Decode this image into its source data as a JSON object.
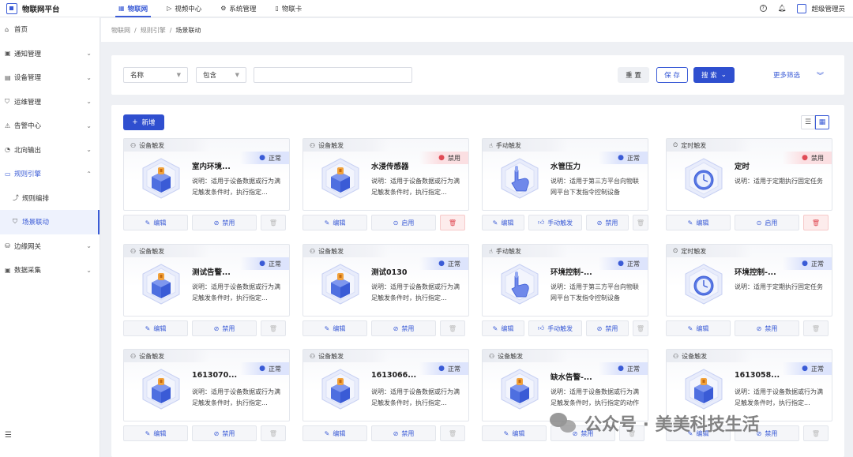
{
  "app": {
    "title": "物联网平台",
    "user": "超级管理员"
  },
  "topnav": [
    {
      "label": "物联网",
      "icon": "grid-icon",
      "active": true
    },
    {
      "label": "视频中心",
      "icon": "video-icon",
      "active": false
    },
    {
      "label": "系统管理",
      "icon": "gear-icon",
      "active": false
    },
    {
      "label": "物联卡",
      "icon": "sim-card-icon",
      "active": false
    }
  ],
  "sidebar": {
    "items": [
      {
        "label": "首页",
        "icon": "home-icon",
        "chevron": ""
      },
      {
        "label": "通知管理",
        "icon": "notice-icon",
        "chevron": "⌄"
      },
      {
        "label": "设备管理",
        "icon": "device-icon",
        "chevron": "⌄"
      },
      {
        "label": "运维管理",
        "icon": "shield-icon",
        "chevron": "⌄"
      },
      {
        "label": "告警中心",
        "icon": "alarm-icon",
        "chevron": "⌄"
      },
      {
        "label": "北向输出",
        "icon": "output-icon",
        "chevron": "⌄"
      },
      {
        "label": "规则引擎",
        "icon": "rule-icon",
        "chevron": "⌃"
      },
      {
        "label": "规则编排",
        "icon": "flow-icon",
        "chevron": ""
      },
      {
        "label": "场景联动",
        "icon": "scene-icon",
        "chevron": ""
      },
      {
        "label": "边缘网关",
        "icon": "gateway-icon",
        "chevron": "⌄"
      },
      {
        "label": "数据采集",
        "icon": "collect-icon",
        "chevron": "⌄"
      }
    ]
  },
  "breadcrumb": [
    "物联网",
    "规则引擎",
    "场景联动"
  ],
  "filter": {
    "field": "名称",
    "operator": "包含",
    "value": "",
    "reset_label": "重 置",
    "save_label": "保 存",
    "search_label": "搜 索",
    "more_label": "更多筛选"
  },
  "add_label": "新增",
  "cards": [
    {
      "trigger": "设备触发",
      "trigger_icon": "device-trigger-icon",
      "status": "正常",
      "status_kind": "ok",
      "title": "室内环境...",
      "desc": "说明：适用于设备数据或行为满足触发条件时，执行指定...",
      "kind": "device",
      "actions": [
        "编辑",
        "禁用"
      ],
      "trash_danger": false
    },
    {
      "trigger": "设备触发",
      "trigger_icon": "device-trigger-icon",
      "status": "禁用",
      "status_kind": "off",
      "title": "水浸传感器",
      "desc": "说明：适用于设备数据或行为满足触发条件时，执行指定...",
      "kind": "device",
      "actions": [
        "编辑",
        "启用"
      ],
      "trash_danger": true
    },
    {
      "trigger": "手动触发",
      "trigger_icon": "hand-trigger-icon",
      "status": "正常",
      "status_kind": "ok",
      "title": "水管压力",
      "desc": "说明：适用于第三方平台向物联网平台下发指令控制设备",
      "kind": "manual",
      "actions": [
        "编辑",
        "手动触发",
        "禁用"
      ],
      "trash_danger": false
    },
    {
      "trigger": "定时触发",
      "trigger_icon": "timer-trigger-icon",
      "status": "禁用",
      "status_kind": "off",
      "title": "定时",
      "desc": "说明：适用于定期执行固定任务",
      "kind": "timer",
      "actions": [
        "编辑",
        "启用"
      ],
      "trash_danger": true
    },
    {
      "trigger": "设备触发",
      "trigger_icon": "device-trigger-icon",
      "status": "正常",
      "status_kind": "ok",
      "title": "测试告警...",
      "desc": "说明：适用于设备数据或行为满足触发条件时，执行指定...",
      "kind": "device",
      "actions": [
        "编辑",
        "禁用"
      ],
      "trash_danger": false
    },
    {
      "trigger": "设备触发",
      "trigger_icon": "device-trigger-icon",
      "status": "正常",
      "status_kind": "ok",
      "title": "测试0130",
      "desc": "说明：适用于设备数据或行为满足触发条件时，执行指定...",
      "kind": "device",
      "actions": [
        "编辑",
        "禁用"
      ],
      "trash_danger": false
    },
    {
      "trigger": "手动触发",
      "trigger_icon": "hand-trigger-icon",
      "status": "正常",
      "status_kind": "ok",
      "title": "环境控制-...",
      "desc": "说明：适用于第三方平台向物联网平台下发指令控制设备",
      "kind": "manual",
      "actions": [
        "编辑",
        "手动触发",
        "禁用"
      ],
      "trash_danger": false
    },
    {
      "trigger": "定时触发",
      "trigger_icon": "timer-trigger-icon",
      "status": "正常",
      "status_kind": "ok",
      "title": "环境控制-...",
      "desc": "说明：适用于定期执行固定任务",
      "kind": "timer",
      "actions": [
        "编辑",
        "禁用"
      ],
      "trash_danger": false
    },
    {
      "trigger": "设备触发",
      "trigger_icon": "device-trigger-icon",
      "status": "正常",
      "status_kind": "ok",
      "title": "1613070...",
      "desc": "说明：适用于设备数据或行为满足触发条件时，执行指定...",
      "kind": "device",
      "actions": [
        "编辑",
        "禁用"
      ],
      "trash_danger": false
    },
    {
      "trigger": "设备触发",
      "trigger_icon": "device-trigger-icon",
      "status": "正常",
      "status_kind": "ok",
      "title": "1613066...",
      "desc": "说明：适用于设备数据或行为满足触发条件时，执行指定...",
      "kind": "device",
      "actions": [
        "编辑",
        "禁用"
      ],
      "trash_danger": false
    },
    {
      "trigger": "设备触发",
      "trigger_icon": "device-trigger-icon",
      "status": "正常",
      "status_kind": "ok",
      "title": "缺水告警-...",
      "desc": "说明：适用于设备数据或行为满足触发条件时，执行指定的动作",
      "kind": "device",
      "actions": [
        "编辑",
        "禁用"
      ],
      "trash_danger": false
    },
    {
      "trigger": "设备触发",
      "trigger_icon": "device-trigger-icon",
      "status": "正常",
      "status_kind": "ok",
      "title": "1613058...",
      "desc": "说明：适用于设备数据或行为满足触发条件时，执行指定...",
      "kind": "device",
      "actions": [
        "编辑",
        "禁用"
      ],
      "trash_danger": false
    }
  ],
  "watermark": "公众号 · 美美科技生活",
  "colors": {
    "accent": "#2f4fcf",
    "danger": "#e04b55",
    "ok": "#3a5bd6"
  }
}
